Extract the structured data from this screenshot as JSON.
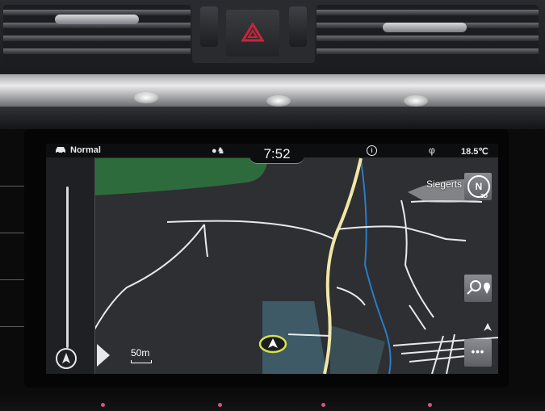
{
  "status_bar": {
    "mode_label": "Normal",
    "clock": "7:52",
    "temperature": "18.5℃",
    "info_icon": "info-circle-icon",
    "phone_icon": "phone-icon"
  },
  "map": {
    "town_label": "Siegerts",
    "compass_label": "N",
    "view_label": "3D",
    "scale_label": "50m",
    "more_label": "•••"
  },
  "colors": {
    "map_background": "#2d2f33",
    "forest": "#2e6b3c",
    "meadow": "#3d5a66",
    "main_road": "#f1e6a6",
    "river": "#2b7cc4",
    "roads": "#e9e9ec",
    "hazard": "#c8253a"
  },
  "icons": [
    "car-icon",
    "hazard-icon",
    "compass-icon",
    "play-arrow-icon",
    "search-location-icon",
    "route-icon",
    "vehicle-marker-icon"
  ]
}
